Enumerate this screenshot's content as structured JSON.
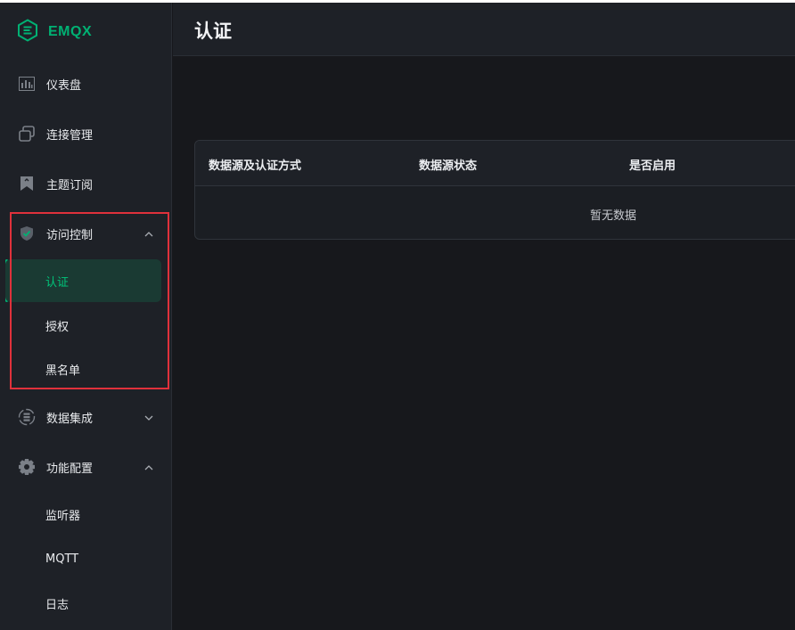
{
  "app": {
    "logo_text": "EMQX",
    "accent": "#00b173",
    "highlight": "#e0313b"
  },
  "sidebar": {
    "items": [
      {
        "label": "仪表盘",
        "icon": "dashboard-icon"
      },
      {
        "label": "连接管理",
        "icon": "connections-icon"
      },
      {
        "label": "主题订阅",
        "icon": "bookmark-icon"
      },
      {
        "label": "访问控制",
        "icon": "shield-check-icon",
        "expanded": true
      },
      {
        "label": "数据集成",
        "icon": "data-integration-icon",
        "expanded": false
      },
      {
        "label": "功能配置",
        "icon": "gear-icon",
        "expanded": true
      }
    ],
    "access_sub": [
      "认证",
      "授权",
      "黑名单"
    ],
    "config_sub": [
      "监听器",
      "MQTT",
      "日志"
    ]
  },
  "header": {
    "title": "认证"
  },
  "table": {
    "columns": [
      "数据源及认证方式",
      "数据源状态",
      "是否启用"
    ],
    "empty_text": "暂无数据"
  }
}
